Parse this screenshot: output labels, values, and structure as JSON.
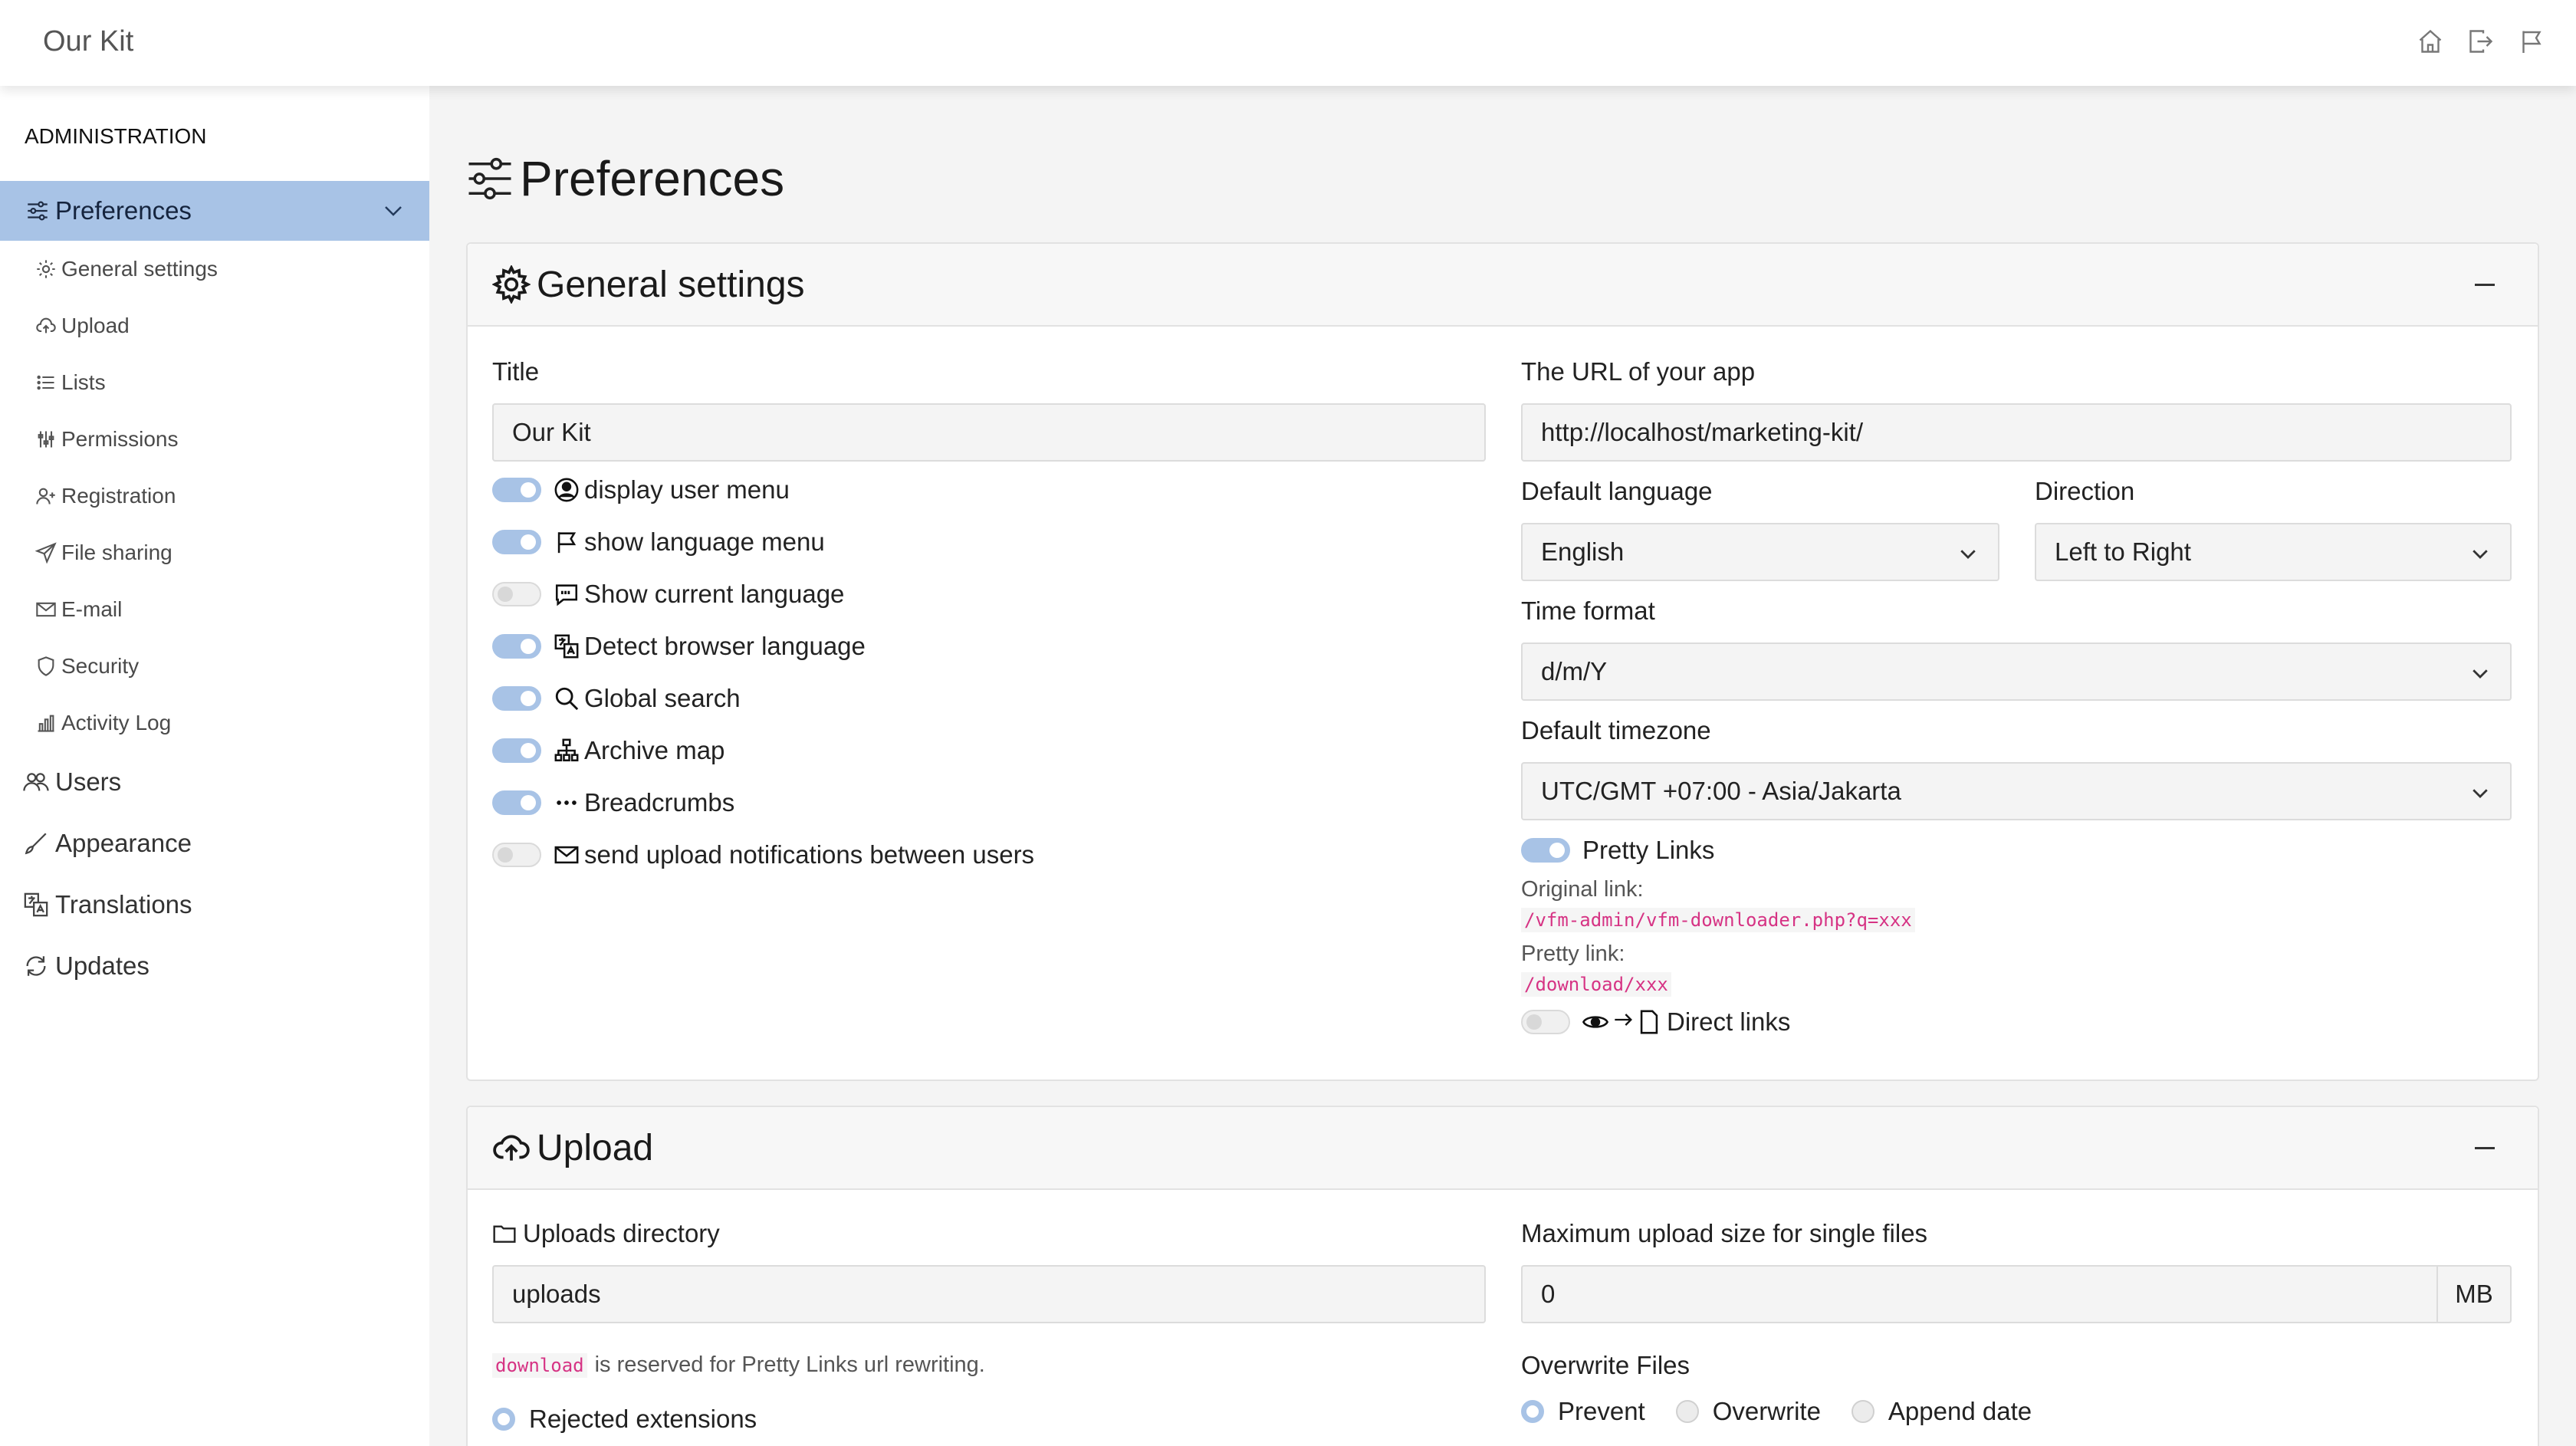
{
  "app": {
    "title": "Our Kit"
  },
  "topbar": {
    "icons": [
      "house-icon",
      "sign-out-icon",
      "flag-icon"
    ]
  },
  "sidebar": {
    "heading": "ADMINISTRATION",
    "active": {
      "label": "Preferences",
      "icon": "sliders-icon"
    },
    "sub_items": [
      {
        "label": "General settings",
        "icon": "gear-icon"
      },
      {
        "label": "Upload",
        "icon": "cloud-upload-icon"
      },
      {
        "label": "Lists",
        "icon": "list-icon"
      },
      {
        "label": "Permissions",
        "icon": "sliders-vertical-icon"
      },
      {
        "label": "Registration",
        "icon": "person-plus-icon"
      },
      {
        "label": "File sharing",
        "icon": "send-icon"
      },
      {
        "label": "E-mail",
        "icon": "envelope-icon"
      },
      {
        "label": "Security",
        "icon": "shield-icon"
      },
      {
        "label": "Activity Log",
        "icon": "bar-chart-icon"
      }
    ],
    "top_items": [
      {
        "label": "Users",
        "icon": "people-icon"
      },
      {
        "label": "Appearance",
        "icon": "brush-icon"
      },
      {
        "label": "Translations",
        "icon": "translate-icon"
      },
      {
        "label": "Updates",
        "icon": "refresh-icon"
      }
    ]
  },
  "page": {
    "title": "Preferences"
  },
  "general": {
    "title": "General settings",
    "title_label": "Title",
    "title_value": "Our Kit",
    "toggles": [
      {
        "label": "display user menu",
        "on": true,
        "icon": "person-circle-icon"
      },
      {
        "label": "show language menu",
        "on": true,
        "icon": "flag-icon"
      },
      {
        "label": "Show current language",
        "on": false,
        "icon": "chat-quote-icon"
      },
      {
        "label": "Detect browser language",
        "on": true,
        "icon": "translate-icon"
      },
      {
        "label": "Global search",
        "on": true,
        "icon": "search-icon"
      },
      {
        "label": "Archive map",
        "on": true,
        "icon": "diagram-icon"
      },
      {
        "label": "Breadcrumbs",
        "on": true,
        "icon": "three-dots-icon"
      },
      {
        "label": "send upload notifications between users",
        "on": false,
        "icon": "envelope-icon"
      }
    ],
    "url_label": "The URL of your app",
    "url_value": "http://localhost/marketing-kit/",
    "language_label": "Default language",
    "language_value": "English",
    "direction_label": "Direction",
    "direction_value": "Left to Right",
    "time_label": "Time format",
    "time_value": "d/m/Y",
    "timezone_label": "Default timezone",
    "timezone_value": "UTC/GMT +07:00 - Asia/Jakarta",
    "pretty_links_label": "Pretty Links",
    "pretty_links_on": true,
    "original_link_label": "Original link:",
    "original_link_value": "/vfm-admin/vfm-downloader.php?q=xxx",
    "pretty_link_label": "Pretty link:",
    "pretty_link_value": "/download/xxx",
    "direct_links_label": "Direct links",
    "direct_links_on": false
  },
  "upload": {
    "title": "Upload",
    "dir_label": "Uploads directory",
    "dir_value": "uploads",
    "reserved_code": "download",
    "reserved_note": "is reserved for Pretty Links url rewriting.",
    "rejected_label": "Rejected extensions",
    "max_label": "Maximum upload size for single files",
    "max_value": "0",
    "max_unit": "MB",
    "overwrite_label": "Overwrite Files",
    "overwrite_options": [
      "Prevent",
      "Overwrite",
      "Append date"
    ],
    "overwrite_selected": "Prevent"
  }
}
